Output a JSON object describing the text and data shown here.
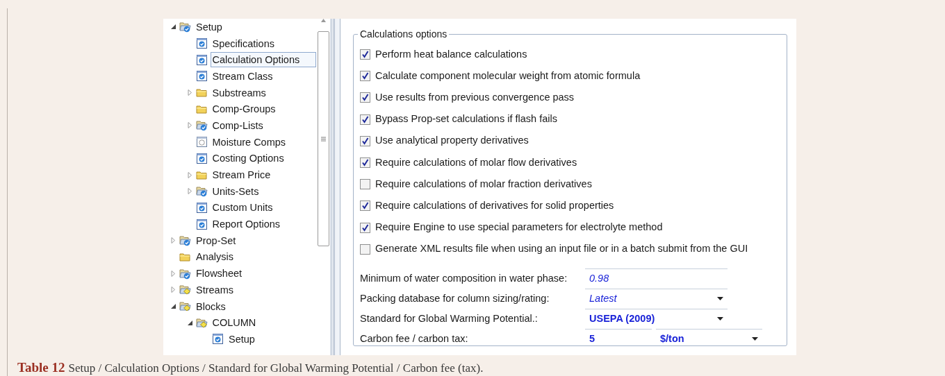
{
  "tree": [
    {
      "label": "Setup",
      "kind": "foldercheck",
      "expanded": true,
      "children": [
        {
          "label": "Specifications",
          "kind": "formcheck",
          "selected": false
        },
        {
          "label": "Calculation Options",
          "kind": "formcheck",
          "selected": true
        },
        {
          "label": "Stream Class",
          "kind": "formcheck",
          "selected": false
        },
        {
          "label": "Substreams",
          "kind": "folder",
          "expanded": false,
          "selected": false
        },
        {
          "label": "Comp-Groups",
          "kind": "folder",
          "selected": false
        },
        {
          "label": "Comp-Lists",
          "kind": "foldercheck",
          "expanded": false,
          "selected": false
        },
        {
          "label": "Moisture Comps",
          "kind": "form",
          "selected": false
        },
        {
          "label": "Costing Options",
          "kind": "formcheck",
          "selected": false
        },
        {
          "label": "Stream Price",
          "kind": "folder",
          "expanded": false,
          "selected": false
        },
        {
          "label": "Units-Sets",
          "kind": "foldercheck",
          "expanded": false,
          "selected": false
        },
        {
          "label": "Custom Units",
          "kind": "formcheck",
          "selected": false
        },
        {
          "label": "Report Options",
          "kind": "formcheck",
          "selected": false
        }
      ],
      "selected": false
    },
    {
      "label": "Prop-Set",
      "kind": "foldercheck",
      "expanded": false,
      "selected": false
    },
    {
      "label": "Analysis",
      "kind": "folder",
      "selected": false
    },
    {
      "label": "Flowsheet",
      "kind": "foldercheck",
      "expanded": false,
      "selected": false
    },
    {
      "label": "Streams",
      "kind": "folderdiamond",
      "expanded": false,
      "selected": false
    },
    {
      "label": "Blocks",
      "kind": "folderdiamond",
      "expanded": true,
      "selected": false,
      "children": [
        {
          "label": "COLUMN",
          "kind": "folderdiamond",
          "expanded": true,
          "selected": false,
          "children": [
            {
              "label": "Setup",
              "kind": "formcheck",
              "selected": false
            }
          ]
        }
      ]
    }
  ],
  "options_group": {
    "title": "Calculations options",
    "checkboxes": [
      {
        "label": "Perform heat balance calculations",
        "checked": true
      },
      {
        "label": "Calculate component molecular weight from atomic formula",
        "checked": true
      },
      {
        "label": "Use results from previous convergence pass",
        "checked": true
      },
      {
        "label": "Bypass Prop-set calculations if flash fails",
        "checked": true
      },
      {
        "label": "Use analytical property derivatives",
        "checked": true
      },
      {
        "label": "Require calculations of molar flow derivatives",
        "checked": true
      },
      {
        "label": "Require calculations of molar fraction derivatives",
        "checked": false
      },
      {
        "label": "Require calculations of derivatives for solid properties",
        "checked": true
      },
      {
        "label": "Require Engine to use special parameters for electrolyte method",
        "checked": true
      },
      {
        "label": "Generate XML results file when using an input file or in a batch submit from the GUI",
        "checked": false
      }
    ],
    "fields": [
      {
        "kind": "text",
        "label": "Minimum of water composition in water phase:",
        "value": "0.98",
        "user_entered": false
      },
      {
        "kind": "dropdown",
        "label": "Packing database for column sizing/rating:",
        "value": "Latest",
        "user_entered": false
      },
      {
        "kind": "dropdown",
        "label": "Standard for Global Warming Potential.:",
        "value": "USEPA (2009)",
        "user_entered": true
      },
      {
        "kind": "value-unit",
        "label": "Carbon fee / carbon tax:",
        "value": "5",
        "unit": "$/ton",
        "user_entered": true
      }
    ]
  },
  "caption": {
    "label": "Table 12",
    "text": "Setup / Calculation Options / Standard for Global Warming Potential / Carbon fee (tax)."
  }
}
